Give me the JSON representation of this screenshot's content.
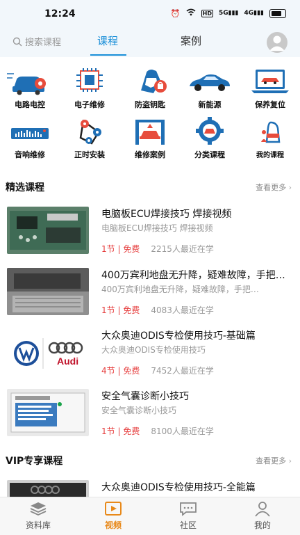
{
  "status_bar": {
    "time": "12:24",
    "network": "HD",
    "signal1": "5G",
    "signal2": "4G"
  },
  "top_nav": {
    "search_placeholder": "搜索课程",
    "tabs": [
      {
        "label": "课程",
        "active": true
      },
      {
        "label": "案例",
        "active": false
      }
    ]
  },
  "categories": [
    {
      "label": "电路电控",
      "icon": "circuit-car-icon"
    },
    {
      "label": "电子维修",
      "icon": "chip-icon"
    },
    {
      "label": "防盗钥匙",
      "icon": "key-shield-icon"
    },
    {
      "label": "新能源",
      "icon": "ev-car-icon"
    },
    {
      "label": "保养复位",
      "icon": "laptop-car-icon"
    },
    {
      "label": "音响维修",
      "icon": "equalizer-icon"
    },
    {
      "label": "正时安装",
      "icon": "timing-belt-icon"
    },
    {
      "label": "维修案例",
      "icon": "car-lift-icon"
    },
    {
      "label": "分类课程",
      "icon": "gear-car-icon"
    },
    {
      "label": "我的课程",
      "icon": "person-car-icon"
    }
  ],
  "featured": {
    "title": "精选课程",
    "more": "查看更多",
    "courses": [
      {
        "title": "电脑板ECU焊接技巧  焊接视频",
        "subtitle": "电脑板ECU焊接技巧  焊接视频",
        "lessons": "1节",
        "price": "免费",
        "learners": "2215人最近在学"
      },
      {
        "title": "400万宾利地盘无升降，疑难故障，手把…",
        "subtitle": "400万宾利地盘无升降，疑难故障，手把…",
        "lessons": "1节",
        "price": "免费",
        "learners": "4083人最近在学"
      },
      {
        "title": "大众奥迪ODIS专检使用技巧-基础篇",
        "subtitle": "大众奥迪ODIS专检使用技巧",
        "lessons": "4节",
        "price": "免费",
        "learners": "7452人最近在学"
      },
      {
        "title": "安全气囊诊断小技巧",
        "subtitle": "安全气囊诊断小技巧",
        "lessons": "1节",
        "price": "免费",
        "learners": "8100人最近在学"
      }
    ]
  },
  "vip": {
    "title": "VIP专享课程",
    "more": "查看更多",
    "courses": [
      {
        "title": "大众奥迪ODIS专检使用技巧-全能篇"
      }
    ]
  },
  "bottom_nav": [
    {
      "label": "资料库",
      "icon": "layers-icon",
      "active": false
    },
    {
      "label": "视频",
      "icon": "play-icon",
      "active": true
    },
    {
      "label": "社区",
      "icon": "chat-icon",
      "active": false
    },
    {
      "label": "我的",
      "icon": "user-icon",
      "active": false
    }
  ],
  "colors": {
    "accent": "#1a8fd8",
    "price_red": "#e63e3e",
    "active_bottom": "#e8891a"
  }
}
